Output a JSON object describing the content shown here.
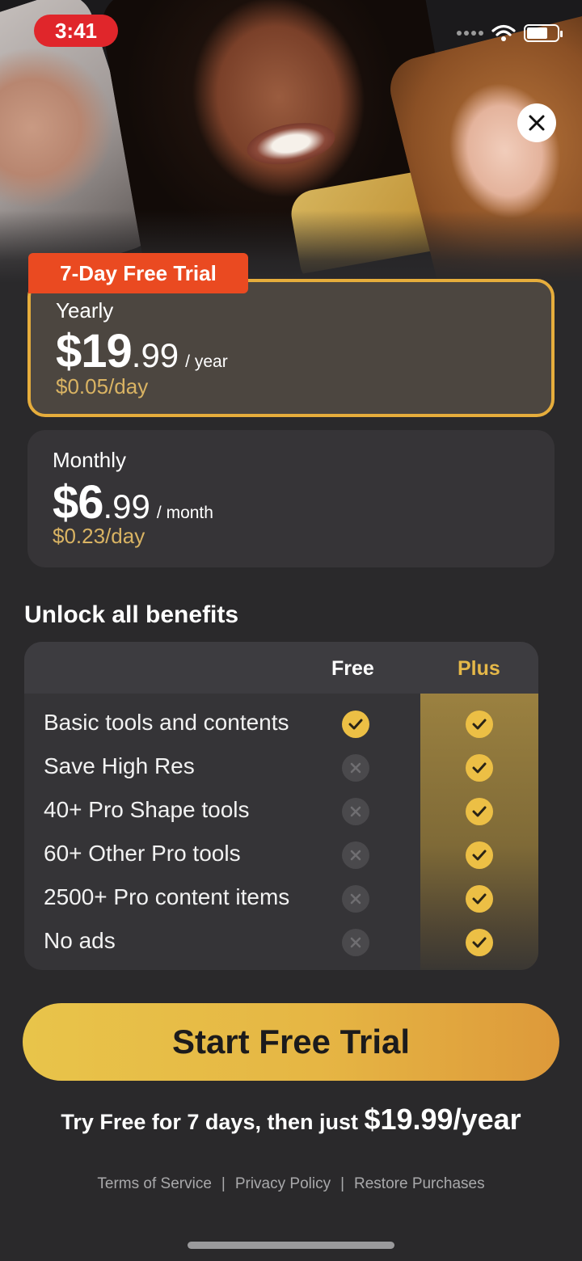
{
  "status_bar": {
    "time": "3:41"
  },
  "trial_badge": "7-Day Free Trial",
  "plans": [
    {
      "name": "Yearly",
      "price_whole": "$19",
      "price_cents": ".99",
      "unit": "/ year",
      "per_day": "$0.05/day",
      "selected": true
    },
    {
      "name": "Monthly",
      "price_whole": "$6",
      "price_cents": ".99",
      "unit": "/ month",
      "per_day": "$0.23/day",
      "selected": false
    }
  ],
  "benefits": {
    "title": "Unlock all benefits",
    "col_free": "Free",
    "col_plus": "Plus",
    "rows": [
      {
        "label": "Basic tools and contents",
        "free": true,
        "plus": true
      },
      {
        "label": "Save High Res",
        "free": false,
        "plus": true
      },
      {
        "label": "40+ Pro Shape tools",
        "free": false,
        "plus": true
      },
      {
        "label": "60+ Other Pro tools",
        "free": false,
        "plus": true
      },
      {
        "label": "2500+ Pro content items",
        "free": false,
        "plus": true
      },
      {
        "label": "No ads",
        "free": false,
        "plus": true
      }
    ]
  },
  "cta": {
    "label": "Start Free Trial"
  },
  "trial_note": {
    "prefix": "Try Free for 7 days, then just ",
    "price": "$19.99/year"
  },
  "footer": {
    "terms": "Terms of Service",
    "privacy": "Privacy Policy",
    "restore": "Restore Purchases",
    "separator": "|"
  },
  "colors": {
    "accent_gold": "#ecbf45",
    "badge_red": "#ea4a21",
    "background": "#2a292b"
  }
}
